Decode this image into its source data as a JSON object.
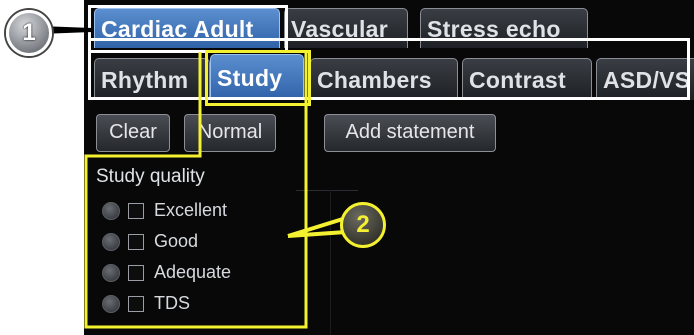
{
  "tabs_row1": [
    "Cardiac Adult",
    "Vascular",
    "Stress echo"
  ],
  "tabs_row2": [
    "Rhythm",
    "Study",
    "Chambers",
    "Contrast",
    "ASD/VS"
  ],
  "buttons": {
    "clear": "Clear",
    "normal": "Normal",
    "add_statement": "Add statement"
  },
  "section": {
    "title": "Study quality",
    "options": [
      "Excellent",
      "Good",
      "Adequate",
      "TDS"
    ]
  },
  "callouts": {
    "one": "1",
    "two": "2"
  },
  "colors": {
    "active_tab": "#3f75bf",
    "callout_yellow": "#f4f230",
    "callout_white": "#ffffff",
    "panel_bg": "#080808"
  }
}
